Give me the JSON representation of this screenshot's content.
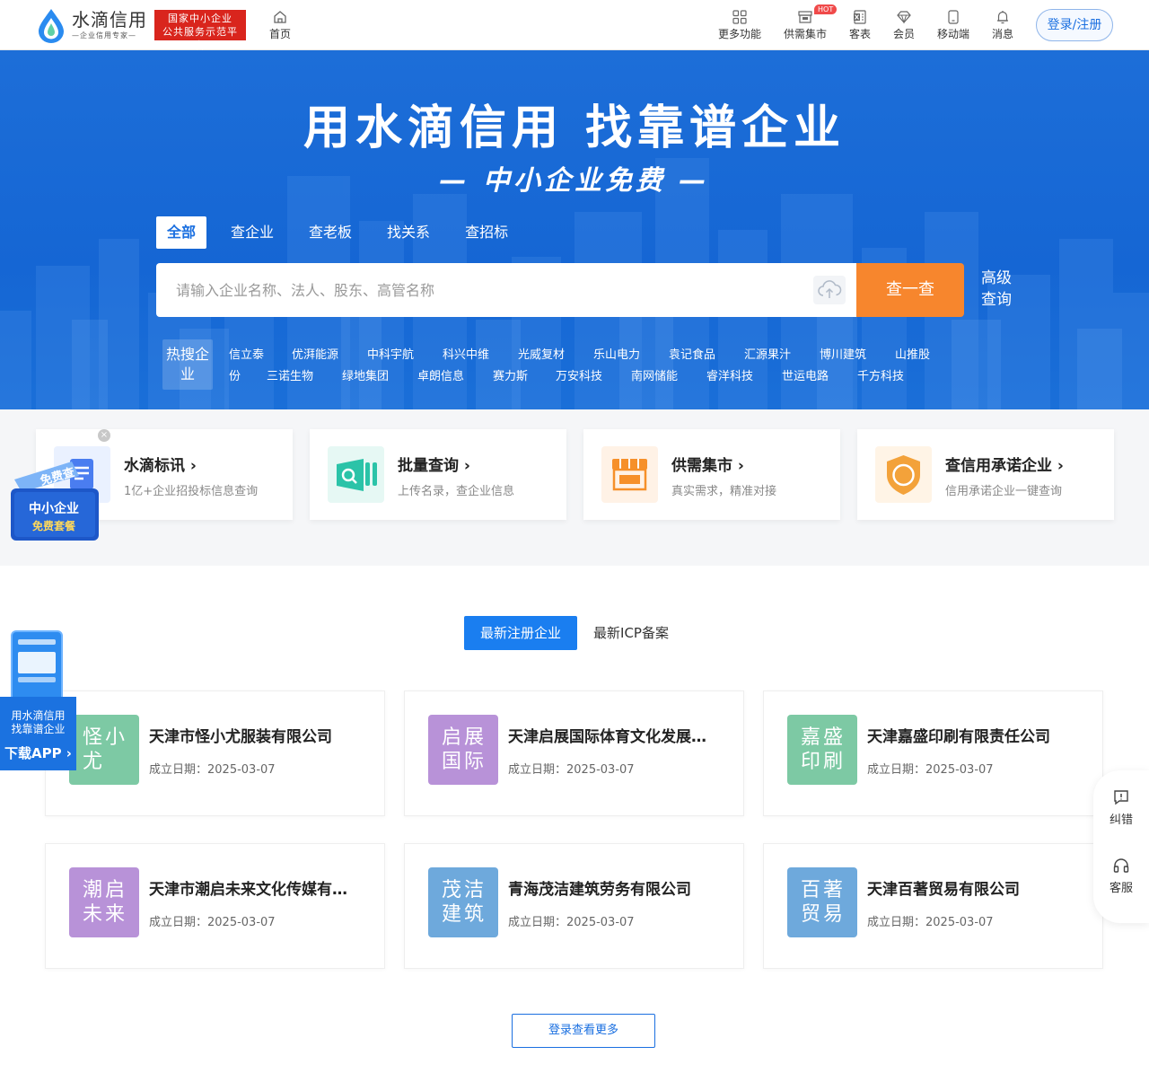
{
  "brand": {
    "name": "水滴信用",
    "tagline": "—企业信用专家—",
    "gov_badge_line1": "国家中小企业",
    "gov_badge_line2": "公共服务示范平台"
  },
  "nav": {
    "home": "首页",
    "items": [
      {
        "label": "更多功能",
        "icon": "grid-icon"
      },
      {
        "label": "供需集市",
        "icon": "market-icon",
        "badge": "HOT"
      },
      {
        "label": "客表",
        "icon": "excel-icon"
      },
      {
        "label": "会员",
        "icon": "diamond-icon"
      },
      {
        "label": "移动端",
        "icon": "mobile-icon"
      },
      {
        "label": "消息",
        "icon": "bell-icon"
      }
    ],
    "login": "登录/注册"
  },
  "hero": {
    "title": "用水滴信用 找靠谱企业",
    "subtitle": "— 中小企业免费 —",
    "tabs": [
      "全部",
      "查企业",
      "查老板",
      "找关系",
      "查招标"
    ],
    "search_placeholder": "请输入企业名称、法人、股东、高管名称",
    "search_button": "查一查",
    "advanced_search": "高级查询",
    "hot_label": "热搜企业",
    "hot_row1": [
      "信立泰",
      "优湃能源",
      "中科宇航",
      "科兴中维",
      "光威复材",
      "乐山电力",
      "袁记食品",
      "汇源果汁",
      "博川建筑",
      "山推股"
    ],
    "hot_row2": [
      "份",
      "三诺生物",
      "绿地集团",
      "卓朗信息",
      "赛力斯",
      "万安科技",
      "南网储能",
      "睿洋科技",
      "世运电路",
      "千方科技"
    ]
  },
  "features": [
    {
      "title": "水滴标讯 ›",
      "desc": "1亿+企业招投标信息查询",
      "color": "#4a7df0"
    },
    {
      "title": "批量查询 ›",
      "desc": "上传名录，查企业信息",
      "color": "#2bc3a8"
    },
    {
      "title": "供需集市 ›",
      "desc": "真实需求，精准对接",
      "color": "#f6902a"
    },
    {
      "title": "查信用承诺企业 ›",
      "desc": "信用承诺企业一键查询",
      "color": "#f3a23a"
    }
  ],
  "promo": {
    "line1": "免费查",
    "line2": "中小企业",
    "line3": "免费套餐"
  },
  "latest": {
    "tabs": [
      "最新注册企业",
      "最新ICP备案"
    ],
    "date_prefix": "成立日期：",
    "companies": [
      {
        "avatar": "怪小尤",
        "name": "天津市怪小尤服装有限公司",
        "date": "2025-03-07",
        "color": "#7dc9a4"
      },
      {
        "avatar": "启展国际",
        "name": "天津启展国际体育文化发展…",
        "date": "2025-03-07",
        "color": "#b892d8"
      },
      {
        "avatar": "嘉盛印刷",
        "name": "天津嘉盛印刷有限责任公司",
        "date": "2025-03-07",
        "color": "#7dc9a4"
      },
      {
        "avatar": "潮启未来",
        "name": "天津市潮启未来文化传媒有…",
        "date": "2025-03-07",
        "color": "#b892d8"
      },
      {
        "avatar": "茂洁建筑",
        "name": "青海茂洁建筑劳务有限公司",
        "date": "2025-03-07",
        "color": "#6ea9dc"
      },
      {
        "avatar": "百著贸易",
        "name": "天津百著贸易有限公司",
        "date": "2025-03-07",
        "color": "#6ea9dc"
      }
    ],
    "more_button": "登录查看更多"
  },
  "app_ad": {
    "line1": "用水滴信用",
    "line2": "找靠谱企业",
    "cta": "下载APP ›"
  },
  "side_tools": [
    {
      "label": "纠错",
      "icon": "feedback-icon"
    },
    {
      "label": "客服",
      "icon": "headset-icon"
    }
  ]
}
